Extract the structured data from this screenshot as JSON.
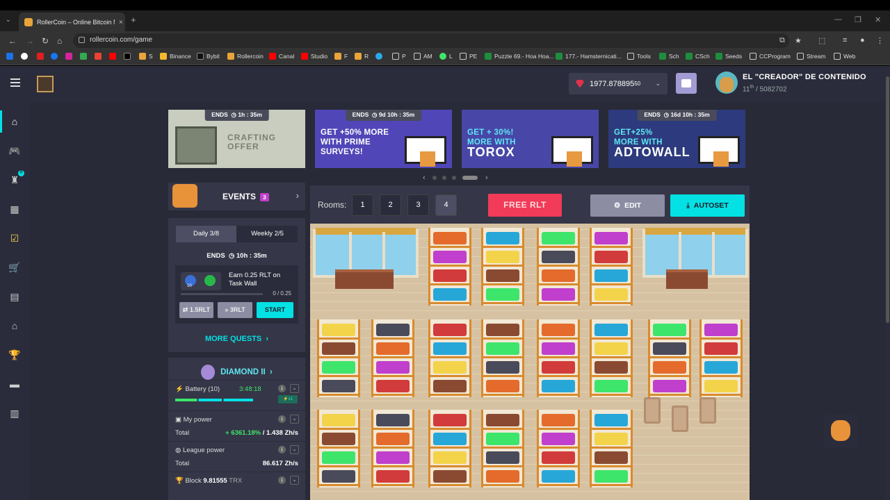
{
  "browser": {
    "tab_title": "RollerCoin – Online Bitcoin Mi",
    "url": "rollercoin.com/game",
    "bookmarks": [
      "S",
      "Binance",
      "Bybit",
      "Rollercoin",
      "Canal",
      "Studio",
      "F",
      "R",
      "P",
      "AM",
      "L",
      "PE",
      "Puzzle 69.- Hoa Hoa...",
      "177.- Hamsternicati...",
      "Tools",
      "Sch",
      "CSch",
      "Seeds",
      "CCProgram",
      "Stream",
      "Web"
    ]
  },
  "header": {
    "balance_main": "1977.878895",
    "balance_small": "50",
    "username": "EL \"CREADOR\" DE CONTENIDO",
    "rank_place": "11",
    "rank_suffix": "th",
    "rank_total": "/ 5082702"
  },
  "banners": [
    {
      "ends_label": "ENDS",
      "time": "1h : 35m",
      "text": "CRAFTING OFFER"
    },
    {
      "ends_label": "ENDS",
      "time": "9d 10h : 35m",
      "text_line1": "GET +50% MORE",
      "text_line2": "WITH PRIME",
      "text_line3": "SURVEYS!"
    },
    {
      "text_line1": "GET + 30%!",
      "text_line2": "MORE WITH",
      "text_line3": "TOROX"
    },
    {
      "ends_label": "ENDS",
      "time": "16d 10h : 35m",
      "text_line1": "GET+25%",
      "text_line2": "MORE WITH",
      "text_line3": "ADTOWALL"
    }
  ],
  "events": {
    "label": "EVENTS",
    "count": "3"
  },
  "quests": {
    "daily": "Daily  3/8",
    "weekly": "Weekly  2/5",
    "ends_label": "ENDS",
    "ends_time": "10h : 35m",
    "xp_value": "10",
    "task": "Earn 0.25 RLT on Task Wall",
    "progress_text": "0 / 0.25",
    "progress": 0,
    "btn_rlt1": "1.5RLT",
    "btn_rlt2": "3RLT",
    "btn_start": "START",
    "more_quests": "MORE QUESTS"
  },
  "league": {
    "title": "DIAMOND II",
    "battery_label": "Battery (10)",
    "battery_time": "3:48:18",
    "my_power_label": "My power",
    "total_label": "Total",
    "my_power_pct": "+ 6361.18%",
    "my_power_value": "1.438 Zh/s",
    "league_power_label": "League power",
    "league_power_value": "86.617 Zh/s",
    "block_label": "Block",
    "block_value": "9.81555",
    "block_currency": "TRX"
  },
  "rooms": {
    "label": "Rooms:",
    "numbers": [
      "1",
      "2",
      "3",
      "4"
    ],
    "active": "4",
    "free_rlt": "FREE RLT",
    "edit": "EDIT",
    "autoset": "AUTOSET"
  },
  "colors": {
    "accent": "#03e1e4",
    "bg": "#292a37",
    "panel": "#353647",
    "red": "#f13b58",
    "purple": "#c03fcc"
  }
}
